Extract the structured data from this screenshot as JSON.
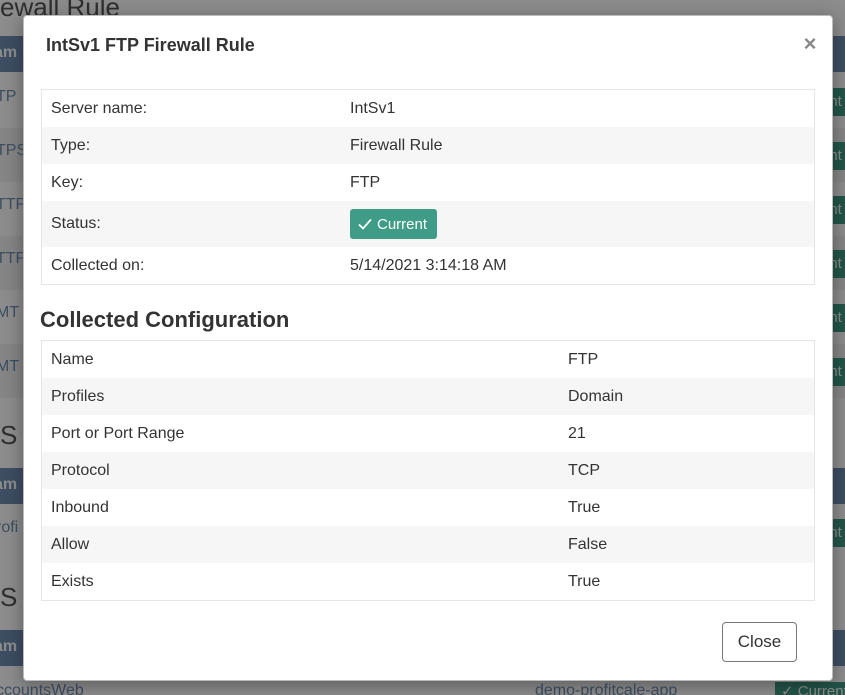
{
  "background": {
    "heading1": "ewall Rule",
    "heading2": "S A",
    "heading3": "S S",
    "header_fragment": "am",
    "rows": [
      "TP",
      "TPS",
      "TTP",
      "TTP",
      "MT",
      "MT"
    ],
    "row2": "rofi",
    "footer_left": "ccountsWeb",
    "footer_mid": "demo-profitcale-app",
    "badge_fragment": "ent",
    "footer_badge": "✓ Current"
  },
  "modal": {
    "title": "IntSv1 FTP Firewall Rule",
    "close_icon": "×",
    "info": [
      {
        "label": "Server name:",
        "value": "IntSv1"
      },
      {
        "label": "Type:",
        "value": "Firewall Rule"
      },
      {
        "label": "Key:",
        "value": "FTP"
      },
      {
        "label": "Status:",
        "value": "Current"
      },
      {
        "label": "Collected on:",
        "value": "5/14/2021 3:14:18 AM"
      }
    ],
    "status_icon": "check-icon",
    "status_color": "#3f9c86",
    "section_title": "Collected Configuration",
    "config": [
      {
        "label": "Name",
        "value": "FTP"
      },
      {
        "label": "Profiles",
        "value": "Domain"
      },
      {
        "label": "Port or Port Range",
        "value": "21"
      },
      {
        "label": "Protocol",
        "value": "TCP"
      },
      {
        "label": "Inbound",
        "value": "True"
      },
      {
        "label": "Allow",
        "value": "False"
      },
      {
        "label": "Exists",
        "value": "True"
      }
    ],
    "close_button": "Close"
  }
}
